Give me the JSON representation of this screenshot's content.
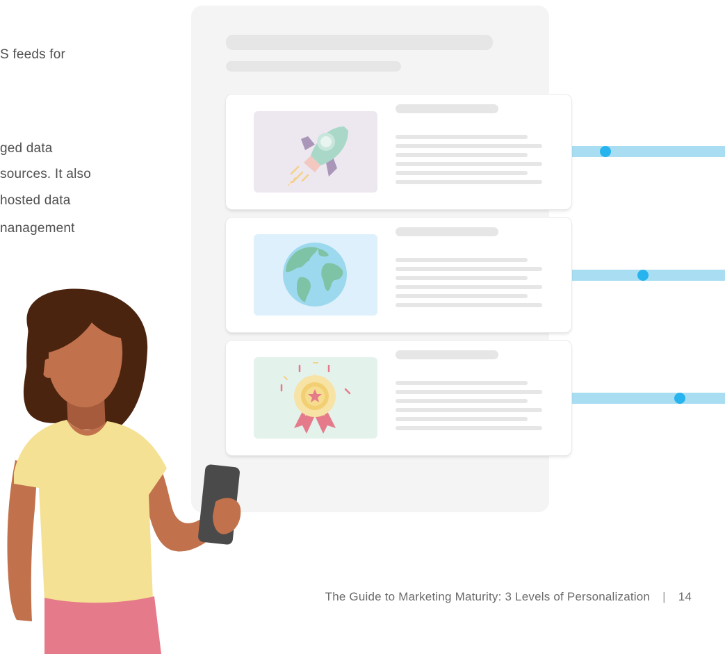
{
  "body_text": [
    "S feeds for",
    "ged data",
    " sources. It also",
    " hosted data",
    "nanagement"
  ],
  "illustration": {
    "card_icons": [
      "rocket-icon",
      "globe-icon",
      "award-medal-icon"
    ],
    "colors": {
      "panel": "#f4f4f4",
      "connector": "#a9def2",
      "connector_dot": "#27b4ee",
      "rocket_bg": "#ede7ef",
      "globe_bg": "#ddf0fb",
      "award_bg": "#e4f2ec",
      "shirt": "#f5e193",
      "skirt": "#e57b8a",
      "skin": "#c1714c",
      "hair": "#4b2410"
    }
  },
  "footer": {
    "title": "The Guide to Marketing Maturity: 3 Levels of Personalization",
    "separator": "|",
    "page_number": "14"
  }
}
